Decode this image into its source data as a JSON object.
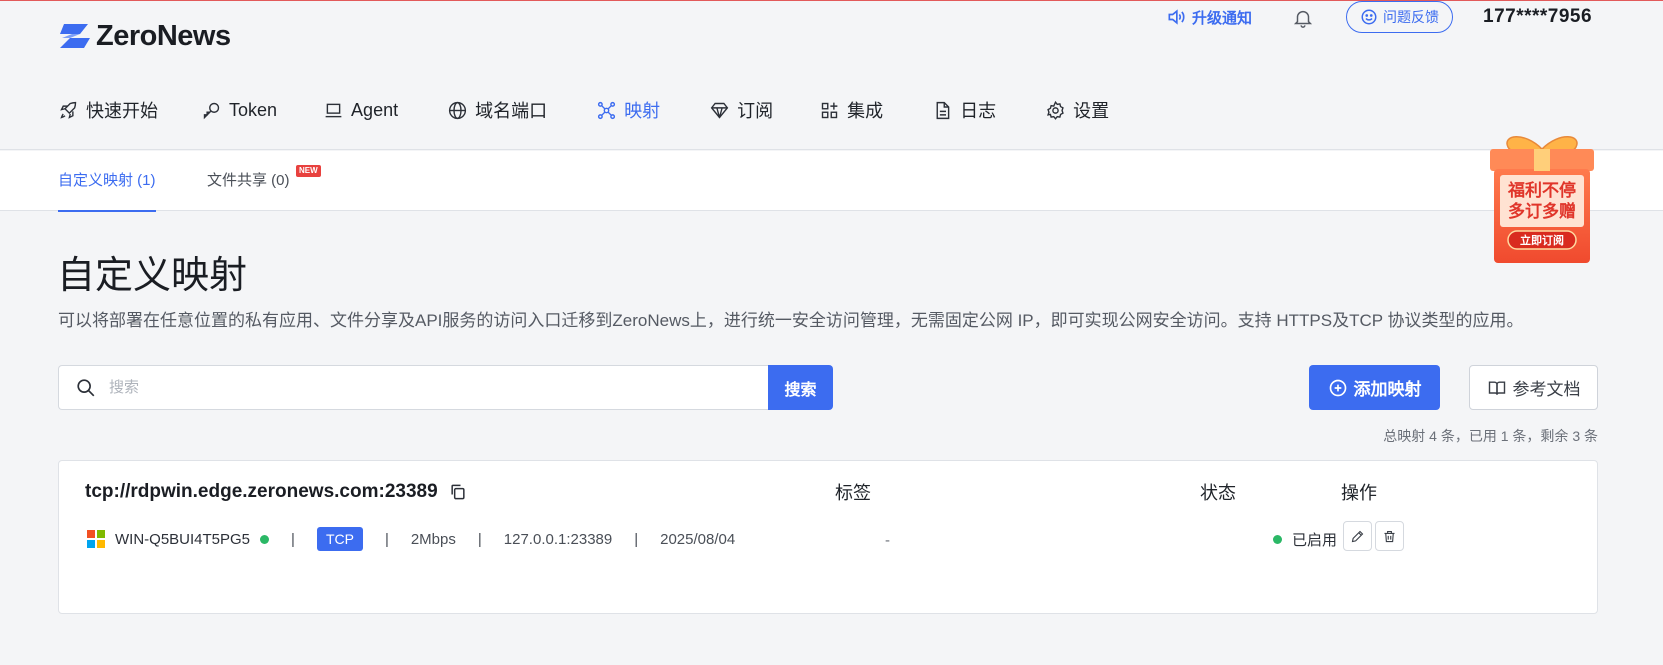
{
  "app": {
    "name": "ZeroNews",
    "brand_color": "#3c6cf0"
  },
  "header": {
    "notice_label": "升级通知",
    "feedback_label": "问题反馈",
    "user_phone": "177****7956"
  },
  "nav": {
    "items": [
      {
        "label": "快速开始",
        "icon": "rocket-icon"
      },
      {
        "label": "Token",
        "icon": "key-icon"
      },
      {
        "label": "Agent",
        "icon": "laptop-icon"
      },
      {
        "label": "域名端口",
        "icon": "globe-icon"
      },
      {
        "label": "映射",
        "icon": "network-icon",
        "active": true
      },
      {
        "label": "订阅",
        "icon": "diamond-icon"
      },
      {
        "label": "集成",
        "icon": "apps-icon"
      },
      {
        "label": "日志",
        "icon": "document-icon"
      },
      {
        "label": "设置",
        "icon": "gear-icon"
      }
    ]
  },
  "subtabs": {
    "custom_mapping": "自定义映射 (1)",
    "file_share": "文件共享 (0)",
    "new_badge": "NEW"
  },
  "promo": {
    "line1": "福利不停",
    "line2": "多订多赠",
    "button": "立即订阅"
  },
  "page": {
    "title": "自定义映射",
    "description": "可以将部署在任意位置的私有应用、文件分享及API服务的访问入口迁移到ZeroNews上，进行统一安全访问管理，无需固定公网 IP，即可实现公网安全访问。支持 HTTPS及TCP 协议类型的应用。"
  },
  "toolbar": {
    "search_placeholder": "搜索",
    "search_button": "搜索",
    "add_button": "添加映射",
    "doc_button": "参考文档",
    "summary": "总映射 4 条，已用 1 条，剩余 3 条"
  },
  "table": {
    "columns": {
      "tags": "标签",
      "status": "状态",
      "actions": "操作"
    },
    "rows": [
      {
        "address": "tcp://rdpwin.edge.zeronews.com:23389",
        "agent_name": "WIN-Q5BUI4T5PG5",
        "protocol": "TCP",
        "bandwidth": "2Mbps",
        "local_address": "127.0.0.1:23389",
        "date": "2025/08/04",
        "tags": "-",
        "status": "已启用"
      }
    ]
  }
}
